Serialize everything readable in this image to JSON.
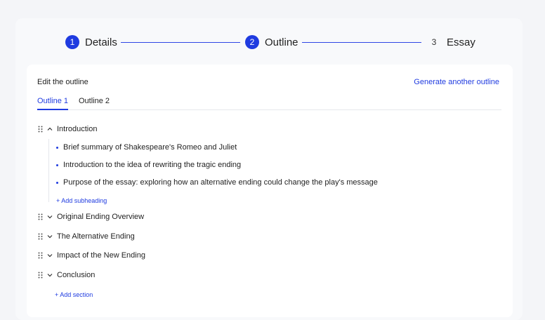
{
  "stepper": {
    "steps": [
      {
        "number": "1",
        "label": "Details"
      },
      {
        "number": "2",
        "label": "Outline"
      },
      {
        "number": "3",
        "label": "Essay"
      }
    ]
  },
  "card": {
    "title": "Edit the outline",
    "generate_link": "Generate another outline",
    "tabs": [
      {
        "label": "Outline 1",
        "active": true
      },
      {
        "label": "Outline 2",
        "active": false
      }
    ],
    "sections": [
      {
        "title": "Introduction",
        "expanded": true,
        "subheadings": [
          "Brief summary of Shakespeare's Romeo and Juliet",
          "Introduction to the idea of rewriting the tragic ending",
          "Purpose of the essay: exploring how an alternative ending could change the play's message"
        ],
        "add_subheading": "+ Add subheading"
      },
      {
        "title": "Original Ending Overview",
        "expanded": false
      },
      {
        "title": "The Alternative Ending",
        "expanded": false
      },
      {
        "title": "Impact of the New Ending",
        "expanded": false
      },
      {
        "title": "Conclusion",
        "expanded": false
      }
    ],
    "add_section": "+ Add section"
  },
  "colors": {
    "accent": "#1f3be0",
    "background": "#f4f5f8"
  }
}
